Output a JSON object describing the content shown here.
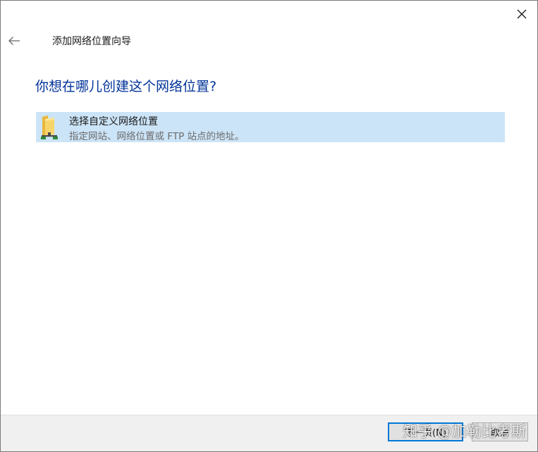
{
  "wizard": {
    "title": "添加网络位置向导",
    "question": "你想在哪儿创建这个网络位置?"
  },
  "options": [
    {
      "title": "选择自定义网络位置",
      "description": "指定网站、网络位置或 FTP 站点的地址。",
      "icon": "network-folder-icon",
      "selected": true
    }
  ],
  "footer": {
    "next_label": "下一页(N)",
    "cancel_label": "取消"
  },
  "watermark": {
    "text": "知乎 @加勒比考斯"
  },
  "colors": {
    "accent": "#0078d7",
    "selection": "#cce4f7",
    "heading": "#003399",
    "footer_bg": "#f0f0f0"
  },
  "icons": {
    "close": "close-icon",
    "back": "back-arrow-icon"
  }
}
